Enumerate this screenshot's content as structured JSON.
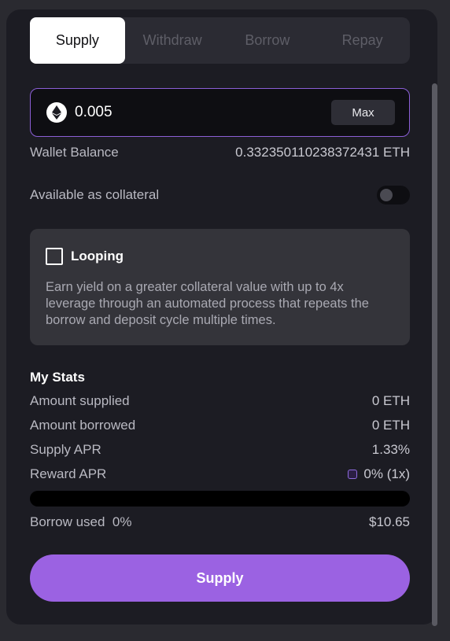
{
  "tabs": [
    "Supply",
    "Withdraw",
    "Borrow",
    "Repay"
  ],
  "active_tab": "Supply",
  "amount": {
    "value": "0.005",
    "token_icon": "eth-icon",
    "max_label": "Max"
  },
  "wallet_balance": {
    "label": "Wallet Balance",
    "value": "0.332350110238372431 ETH"
  },
  "collateral": {
    "label": "Available as collateral",
    "enabled": false
  },
  "looping": {
    "title": "Looping",
    "checked": false,
    "description": "Earn yield on a greater collateral value with up to 4x leverage through an automated process that repeats the borrow and deposit cycle multiple times."
  },
  "stats": {
    "title": "My Stats",
    "amount_supplied": {
      "label": "Amount supplied",
      "value": "0 ETH"
    },
    "amount_borrowed": {
      "label": "Amount borrowed",
      "value": "0 ETH"
    },
    "supply_apr": {
      "label": "Supply APR",
      "value": "1.33%"
    },
    "reward_apr": {
      "label": "Reward APR",
      "value": "0% (1x)"
    },
    "borrow_used": {
      "label": "Borrow used",
      "percent": "0%",
      "value": "$10.65",
      "fraction": 0
    }
  },
  "supply_button": "Supply",
  "colors": {
    "accent": "#9b62e2",
    "panel": "#1c1c23",
    "input_border": "#8b5fd6"
  }
}
